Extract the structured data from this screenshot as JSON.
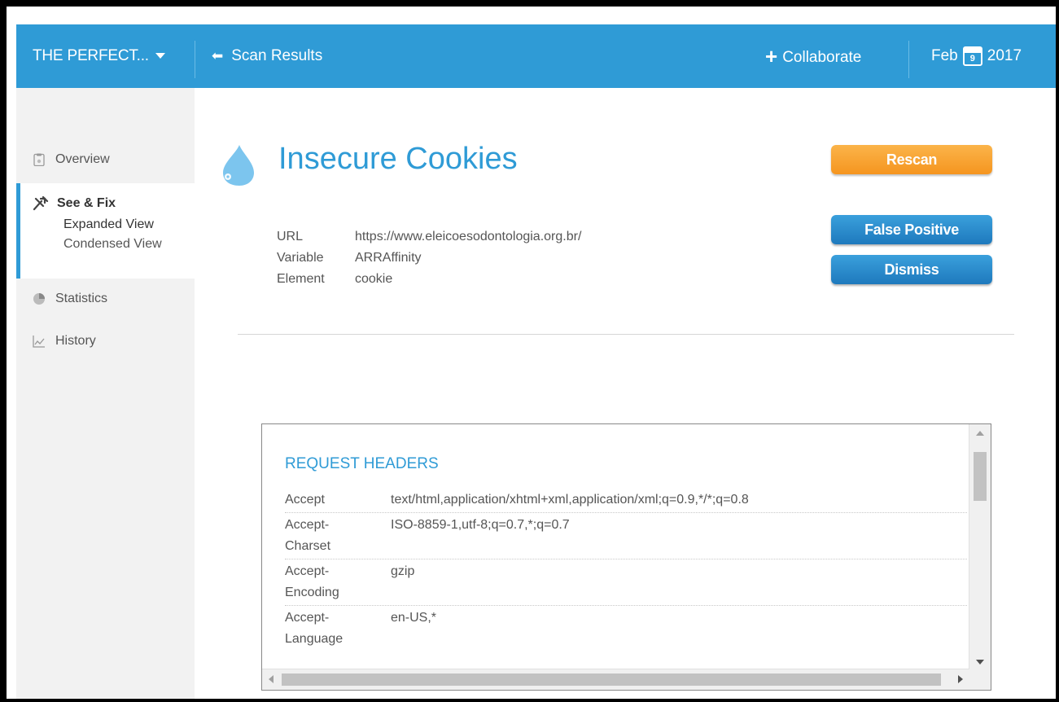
{
  "topbar": {
    "project": "THE PERFECT...",
    "back_label": "Scan Results",
    "collaborate_label": "Collaborate",
    "date_month": "Feb",
    "date_day": "9",
    "date_year": "2017"
  },
  "sidebar": {
    "items": [
      {
        "label": "Overview",
        "icon": "clipboard-icon"
      },
      {
        "label": "See & Fix",
        "icon": "tools-icon"
      },
      {
        "label": "Statistics",
        "icon": "pie-chart-icon"
      },
      {
        "label": "History",
        "icon": "line-chart-icon"
      }
    ],
    "sub_items": [
      "Expanded View",
      "Condensed View"
    ]
  },
  "issue": {
    "title": "Insecure Cookies",
    "icon": "drop-icon",
    "fields": [
      {
        "key": "URL",
        "value": "https://www.eleicoesodontologia.org.br/"
      },
      {
        "key": "Variable",
        "value": "ARRAffinity"
      },
      {
        "key": "Element",
        "value": "cookie"
      }
    ]
  },
  "actions": {
    "rescan": "Rescan",
    "false_positive": "False Positive",
    "dismiss": "Dismiss"
  },
  "request_headers": {
    "title": "REQUEST HEADERS",
    "rows": [
      {
        "key": "Accept",
        "value": "text/html,application/xhtml+xml,application/xml;q=0.9,*/*;q=0.8"
      },
      {
        "key": "Accept-\nCharset",
        "key1": "Accept-",
        "key2": "Charset",
        "value": "ISO-8859-1,utf-8;q=0.7,*;q=0.7"
      },
      {
        "key1": "Accept-",
        "key2": "Encoding",
        "value": "gzip"
      },
      {
        "key1": "Accept-",
        "key2": "Language",
        "value": "en-US,*"
      }
    ]
  },
  "colors": {
    "brand_blue": "#2f9bd6",
    "rescan_orange": "#f5951f",
    "button_blue": "#1e79bd"
  }
}
